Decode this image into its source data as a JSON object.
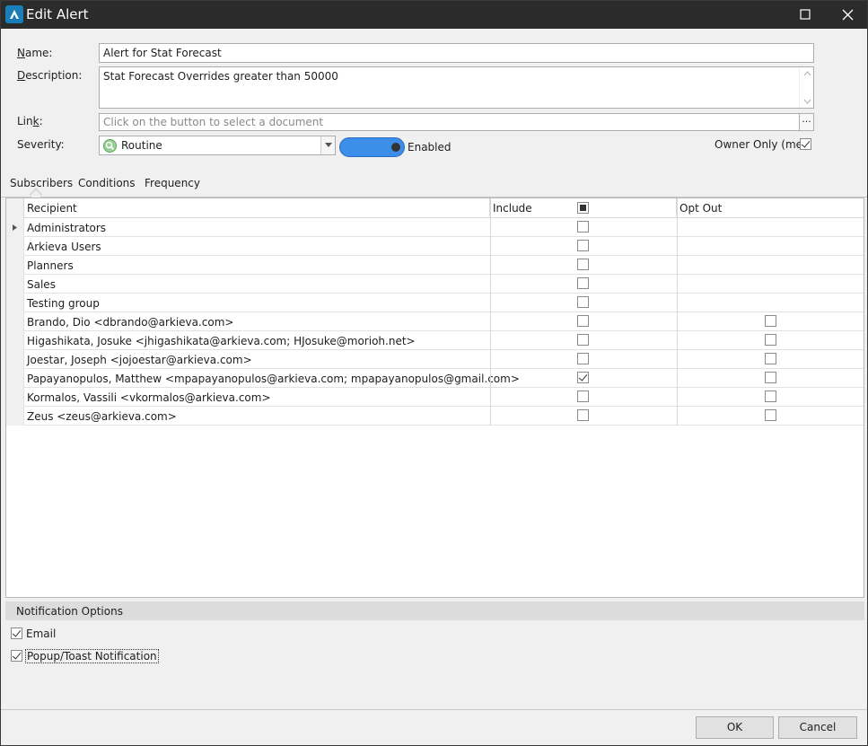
{
  "window": {
    "title": "Edit Alert"
  },
  "form": {
    "name_label_u": "N",
    "name_label_rest": "ame:",
    "name_value": "Alert for Stat Forecast",
    "description_label_u": "D",
    "description_label_rest": "escription:",
    "description_value": "Stat Forecast Overrides greater than 50000",
    "link_label_pre": "Lin",
    "link_label_u": "k",
    "link_label_post": ":",
    "link_placeholder": "Click on the button to select a document",
    "link_button": "...",
    "severity_label": "Severity:",
    "severity_value": "Routine",
    "toggle_label": "Enabled",
    "owner_only_label": "Owner Only (me)",
    "owner_only_checked": true
  },
  "tabs": [
    {
      "label": "Subscribers",
      "active": true
    },
    {
      "label": "Conditions",
      "active": false
    },
    {
      "label": "Frequency",
      "active": false
    }
  ],
  "grid": {
    "headers": {
      "recipient": "Recipient",
      "include": "Include",
      "opt_out": "Opt Out"
    },
    "rows": [
      {
        "recipient": "Administrators",
        "include": false,
        "opt_out": null
      },
      {
        "recipient": "Arkieva Users",
        "include": false,
        "opt_out": null
      },
      {
        "recipient": "Planners",
        "include": false,
        "opt_out": null
      },
      {
        "recipient": "Sales",
        "include": false,
        "opt_out": null
      },
      {
        "recipient": "Testing group",
        "include": false,
        "opt_out": null
      },
      {
        "recipient": "Brando, Dio <dbrando@arkieva.com>",
        "include": false,
        "opt_out": false
      },
      {
        "recipient": "Higashikata, Josuke <jhigashikata@arkieva.com; HJosuke@morioh.net>",
        "include": false,
        "opt_out": false
      },
      {
        "recipient": "Joestar, Joseph <jojoestar@arkieva.com>",
        "include": false,
        "opt_out": false
      },
      {
        "recipient": "Papayanopulos, Matthew <mpapayanopulos@arkieva.com; mpapayanopulos@gmail.com>",
        "include": true,
        "opt_out": false
      },
      {
        "recipient": "Kormalos, Vassili <vkormalos@arkieva.com>",
        "include": false,
        "opt_out": false
      },
      {
        "recipient": "Zeus <zeus@arkieva.com>",
        "include": false,
        "opt_out": false
      }
    ]
  },
  "notifications": {
    "title": "Notification Options",
    "items": [
      {
        "label": "Email",
        "checked": true
      },
      {
        "label": "Popup/Toast Notification",
        "checked": true
      }
    ]
  },
  "buttons": {
    "ok": "OK",
    "cancel": "Cancel"
  },
  "colors": {
    "titlebar": "#2b2b2b",
    "toggle": "#3c8ee8",
    "accent": "#1a7fb8"
  }
}
